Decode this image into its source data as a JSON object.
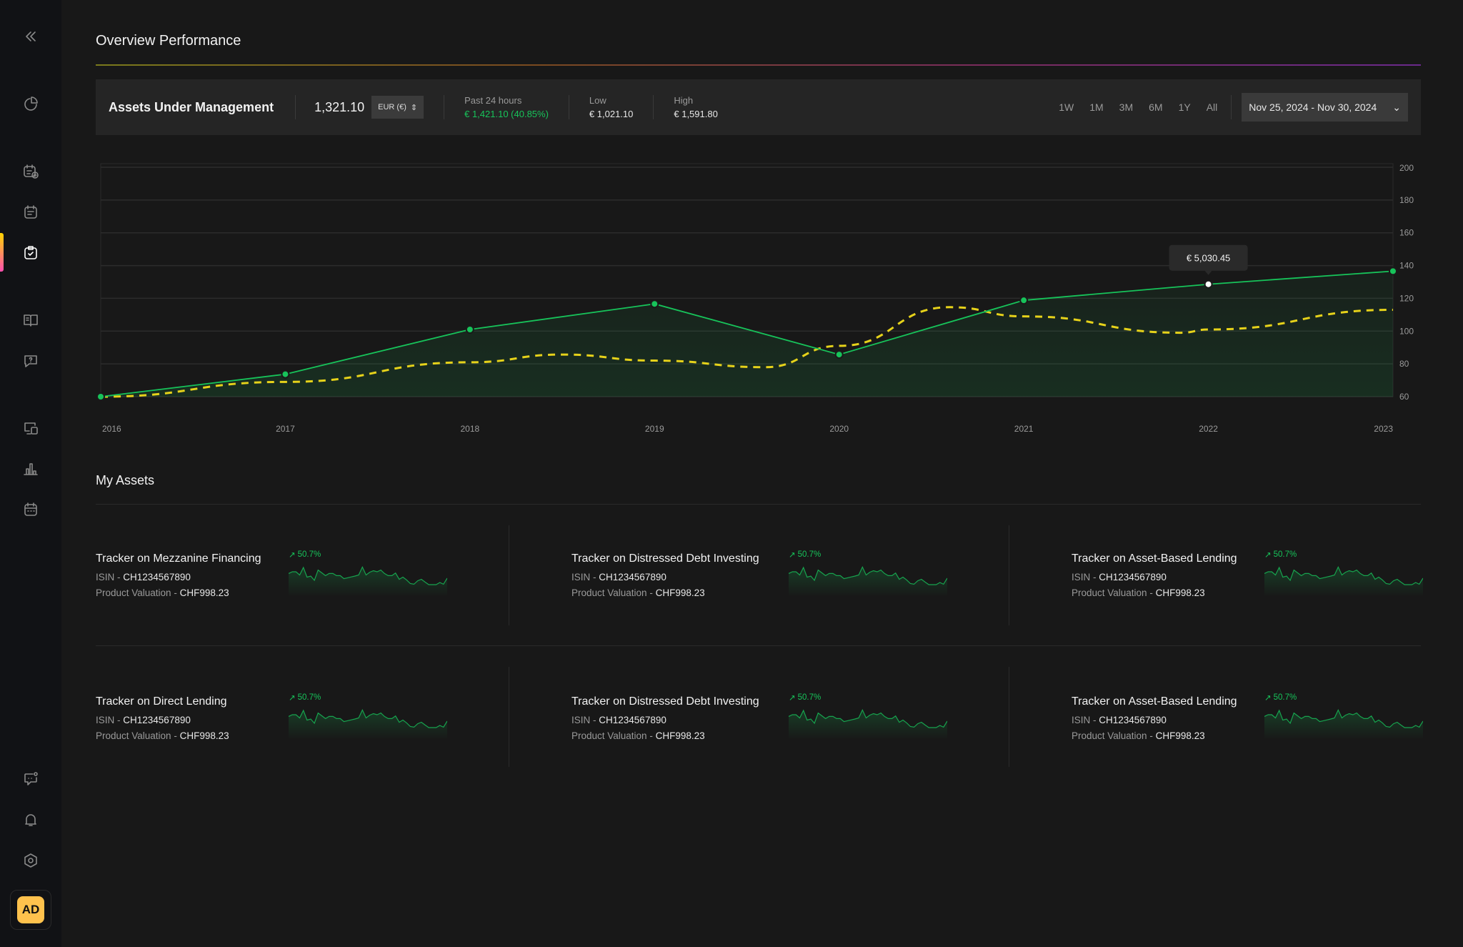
{
  "header": {
    "title": "Overview Performance"
  },
  "stats": {
    "label": "Assets Under Management",
    "value": "1,321.10",
    "currency": "EUR (€)",
    "past_label": "Past 24 hours",
    "past_value": "€ 1,421.10 (40.85%)",
    "low_label": "Low",
    "low_value": "€ 1,021.10",
    "high_label": "High",
    "high_value": "€ 1,591.80",
    "ranges": [
      "1W",
      "1M",
      "3M",
      "6M",
      "1Y",
      "All"
    ],
    "date_range": "Nov 25, 2024 - Nov 30, 2024"
  },
  "colors": {
    "green": "#17c35a",
    "yellow": "#e6d21a",
    "accent_gradient": [
      "#ffd400",
      "#ff4fb0"
    ],
    "avatar": "#ffc24d"
  },
  "chart_data": {
    "type": "line",
    "xlabel": "",
    "ylabel": "",
    "x_ticks": [
      "2016",
      "2017",
      "2018",
      "2019",
      "2020",
      "2021",
      "2022",
      "2023"
    ],
    "y_ticks": [
      200,
      180,
      160,
      140,
      120,
      100,
      80,
      60
    ],
    "xlim": [
      2016,
      2023
    ],
    "ylim": [
      60,
      200
    ],
    "grid": true,
    "series": [
      {
        "style": "solid-area",
        "color": "#17c35a",
        "x": [
          2016,
          2017,
          2018,
          2019,
          2020,
          2021,
          2022,
          2023
        ],
        "y": [
          60,
          73.7,
          101,
          116.6,
          85.7,
          118.8,
          128.6,
          136.6
        ]
      },
      {
        "style": "dashed",
        "color": "#e6d21a",
        "x": [
          2016,
          2017,
          2018,
          2018.5,
          2019,
          2019.6,
          2020,
          2020.6,
          2021,
          2021.85,
          2022,
          2023
        ],
        "y": [
          60,
          69,
          81,
          85.7,
          82,
          78,
          91,
          114.6,
          109,
          99,
          101,
          113
        ]
      }
    ],
    "tooltip": {
      "x": 2022,
      "label": "€ 5,030.45"
    }
  },
  "assets": {
    "title": "My Assets",
    "isin_label": "ISIN - ",
    "valuation_label": "Product Valuation - ",
    "sparkline": [
      0.62,
      0.7,
      0.7,
      0.55,
      0.9,
      0.45,
      0.5,
      0.3,
      0.78,
      0.65,
      0.52,
      0.62,
      0.62,
      0.52,
      0.52,
      0.38,
      0.42,
      0.46,
      0.5,
      0.55,
      0.92,
      0.55,
      0.68,
      0.75,
      0.7,
      0.78,
      0.62,
      0.52,
      0.52,
      0.64,
      0.35,
      0.45,
      0.32,
      0.15,
      0.12,
      0.28,
      0.35,
      0.22,
      0.1,
      0.1,
      0.1,
      0.2,
      0.12,
      0.4
    ],
    "items": [
      {
        "name": "Tracker on Mezzanine Financing",
        "isin": "CH1234567890",
        "valuation": "CHF998.23",
        "change": "50.7%"
      },
      {
        "name": "Tracker on Distressed Debt Investing",
        "isin": "CH1234567890",
        "valuation": "CHF998.23",
        "change": "50.7%"
      },
      {
        "name": "Tracker on Asset-Based Lending",
        "isin": "CH1234567890",
        "valuation": "CHF998.23",
        "change": "50.7%"
      },
      {
        "name": "Tracker on Direct Lending",
        "isin": "CH1234567890",
        "valuation": "CHF998.23",
        "change": "50.7%"
      },
      {
        "name": "Tracker on Distressed Debt Investing",
        "isin": "CH1234567890",
        "valuation": "CHF998.23",
        "change": "50.7%"
      },
      {
        "name": "Tracker on Asset-Based Lending",
        "isin": "CH1234567890",
        "valuation": "CHF998.23",
        "change": "50.7%"
      }
    ]
  },
  "user": {
    "initials": "AD"
  }
}
